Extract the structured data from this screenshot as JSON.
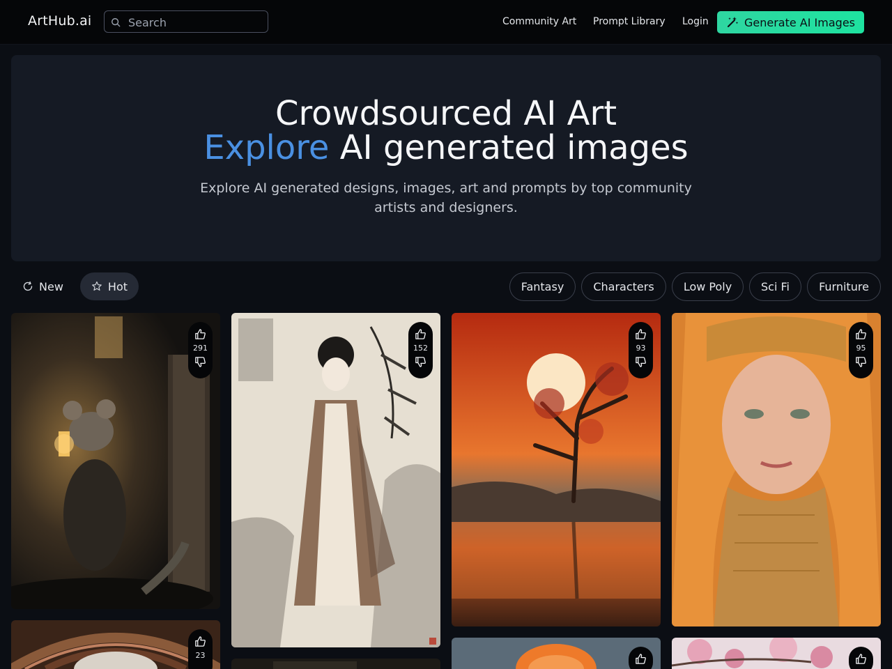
{
  "header": {
    "logo": "ArtHub.ai",
    "search_placeholder": "Search",
    "nav": [
      "Community Art",
      "Prompt Library",
      "Login"
    ],
    "cta": "Generate AI Images"
  },
  "hero": {
    "title_line1": "Crowdsourced AI Art",
    "title_accent": "Explore",
    "title_rest": " AI generated images",
    "subtitle": "Explore AI generated designs, images, art and prompts by top community artists and designers."
  },
  "sort": {
    "new_label": "New",
    "hot_label": "Hot",
    "active": "Hot"
  },
  "categories": [
    "Fantasy",
    "Characters",
    "Low Poly",
    "Sci Fi",
    "Furniture"
  ],
  "gallery": {
    "votes": [
      "291",
      "152",
      "93",
      "95",
      "23"
    ],
    "items": [
      {
        "subject": "mouse with lantern"
      },
      {
        "subject": "ink painting of girl in robes"
      },
      {
        "subject": "tree at sunset with reflection"
      },
      {
        "subject": "woman in orange hood"
      },
      {
        "subject": "ornate mechanical dome"
      },
      {
        "subject": "dark scene"
      },
      {
        "subject": "orange cap"
      },
      {
        "subject": "cherry blossoms"
      }
    ]
  },
  "colors": {
    "accent": "#4a90e2",
    "cta_green": "#2fd6a1",
    "hero_bg": "#151a24",
    "page_bg": "#0b0e14"
  },
  "icons": [
    "search-icon",
    "magic-wand-icon",
    "refresh-icon",
    "star-icon",
    "thumbs-up-icon",
    "thumbs-down-icon"
  ]
}
